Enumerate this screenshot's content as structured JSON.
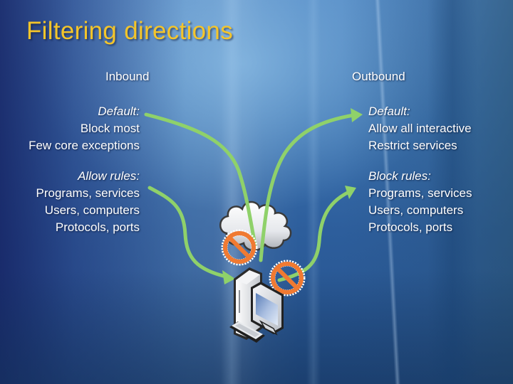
{
  "slide": {
    "title": "Filtering directions",
    "inbound": {
      "heading": "Inbound",
      "default": {
        "label": "Default:",
        "lines": [
          "Block most",
          "Few core exceptions"
        ]
      },
      "rules": {
        "label": "Allow rules:",
        "lines": [
          "Programs, services",
          "Users, computers",
          "Protocols, ports"
        ]
      }
    },
    "outbound": {
      "heading": "Outbound",
      "default": {
        "label": "Default:",
        "lines": [
          "Allow all interactive",
          "Restrict services"
        ]
      },
      "rules": {
        "label": "Block rules:",
        "lines": [
          "Programs, services",
          "Users, computers",
          "Protocols, ports"
        ]
      }
    }
  },
  "diagram": {
    "icons": [
      "cloud-icon",
      "computer-icon",
      "blocked-sign-icon",
      "arrow-icon"
    ],
    "colors": {
      "title": "#f4c52a",
      "arrow": "#8fd16a",
      "blocked_sign": "#f07a32",
      "text": "#ffffff"
    }
  }
}
